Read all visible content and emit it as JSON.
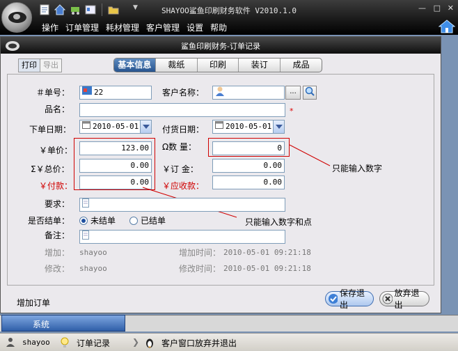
{
  "app": {
    "title": "SHAYOO鲨鱼印刷财务软件 V2010.1.0",
    "menu": [
      "操作",
      "订单管理",
      "耗材管理",
      "客户管理",
      "设置",
      "帮助"
    ],
    "quick_icons": [
      "document-icon",
      "home-icon",
      "cart-icon",
      "card-icon",
      "folder-icon"
    ]
  },
  "dialog": {
    "title": "鲨鱼印刷财务-订单记录",
    "subtabs": [
      "打印",
      "导出"
    ],
    "tabs": [
      "基本信息",
      "裁纸",
      "印刷",
      "装订",
      "成品"
    ],
    "form": {
      "order_no": {
        "label": "＃单号：",
        "value": "22"
      },
      "customer": {
        "label": "客户名称：",
        "value": "",
        "browse": "..."
      },
      "product": {
        "label": "品名：",
        "value": "",
        "required": "*"
      },
      "order_date": {
        "label": "下单日期：",
        "value": "2010-05-01"
      },
      "delivery_date": {
        "label": "付货日期：",
        "value": "2010-05-01"
      },
      "unit_price": {
        "label": "￥单价：",
        "value": "123.00"
      },
      "quantity": {
        "label": "Ω数  量：",
        "value": "0"
      },
      "total": {
        "label": "Σ￥总价：",
        "value": "0.00"
      },
      "deposit": {
        "label": "￥订  金：",
        "value": "0.00"
      },
      "paid": {
        "label": "￥付款：",
        "value": "0.00"
      },
      "receivable": {
        "label": "￥应收款：",
        "value": "0.00"
      },
      "requirement": {
        "label": "要求：",
        "value": ""
      },
      "settled": {
        "label": "是否结单：",
        "options": [
          "未结单",
          "已结单"
        ],
        "selected": "未结单"
      },
      "remark": {
        "label": "备注：",
        "value": ""
      },
      "added_by": {
        "label": "增加：",
        "value": "shayoo"
      },
      "added_time": {
        "label": "增加时间：",
        "value": "2010-05-01 09:21:18"
      },
      "modified_by": {
        "label": "修改：",
        "value": "shayoo"
      },
      "modified_time": {
        "label": "修改时间：",
        "value": "2010-05-01 09:21:18"
      }
    },
    "annotations": {
      "numbers_only": "只能输入数字",
      "numbers_and_dot": "只能输入数字和点"
    },
    "footer_label": "增加订单",
    "buttons": {
      "save": "保存退出",
      "cancel": "放弃退出"
    }
  },
  "nav": {
    "selected": "系统"
  },
  "status": {
    "user": "shayoo",
    "item1": "订单记录",
    "item2": "客户窗口放弃并退出"
  },
  "colors": {
    "annotation": "#d00000",
    "tab_active": "#2f5fa8"
  }
}
